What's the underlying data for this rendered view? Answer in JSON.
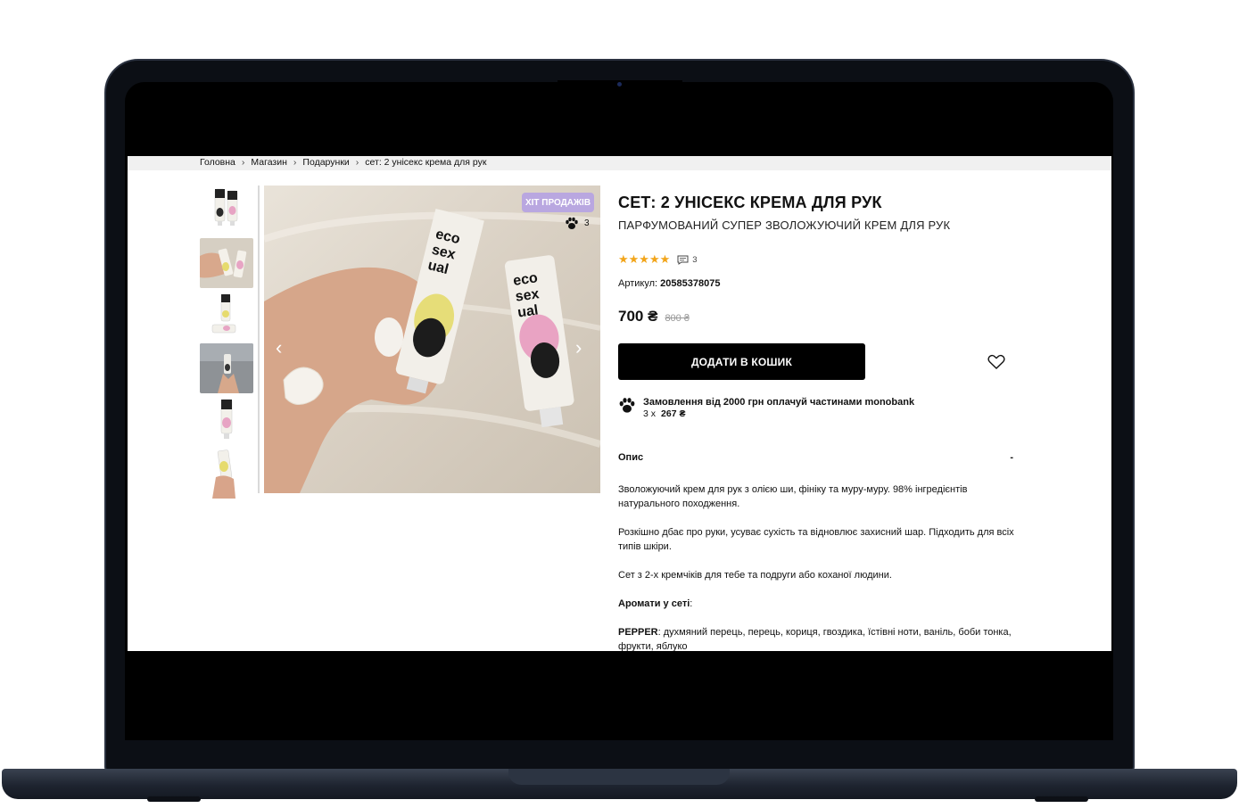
{
  "breadcrumb": {
    "items": [
      "Головна",
      "Магазин",
      "Подарунки",
      "сет: 2 унісекс крема для рук"
    ],
    "separator": "›"
  },
  "gallery": {
    "badge": "ХІТ ПРОДАЖІВ",
    "paw_count": "3",
    "thumbnail_count": 6
  },
  "product": {
    "title": "СЕТ: 2 УНІСЕКС КРЕМА ДЛЯ РУК",
    "subtitle": "ПАРФУМОВАНИЙ СУПЕР ЗВОЛОЖУЮЧИЙ КРЕМ ДЛЯ РУК",
    "rating_stars": "★★★★★",
    "rating_value": 5,
    "reviews_count": "3",
    "sku_label": "Артикул:",
    "sku_value": "20585378075",
    "price": "700 ₴",
    "old_price": "800 ₴",
    "add_to_cart": "ДОДАТИ В КОШИК"
  },
  "installments": {
    "text": "Замовлення від 2000 грн оплачуй частинами monobank",
    "multiplier": "3 х",
    "amount": "267 ₴"
  },
  "description": {
    "header": "Опис",
    "toggle": "-",
    "p1": "Зволожуючий крем для рук з олією ши, фініку та муру-муру. 98% інгредієнтів натурального походження.",
    "p2": "Розкішно дбає про руки, усуває сухість та відновлює захисний шар. Підходить для всіх типів шкіри.",
    "p3": "Сет з 2-х кремчіків для тебе та подруги або коханої людини.",
    "aromas_label": "Аромати у сеті",
    "aromas_colon": ":",
    "pepper_label": "PEPPER",
    "pepper_text": ": духмяний перець, перець, кориця, гвоздика, їстівні ноти, ваніль, боби тонка, фрукти, яблуко"
  },
  "colors": {
    "badge": "#b9a7e0",
    "stars": "#f2a51a",
    "button": "#000000"
  },
  "icons": [
    "paw-icon",
    "chat-icon",
    "heart-icon",
    "chevron-left-icon",
    "chevron-right-icon"
  ]
}
